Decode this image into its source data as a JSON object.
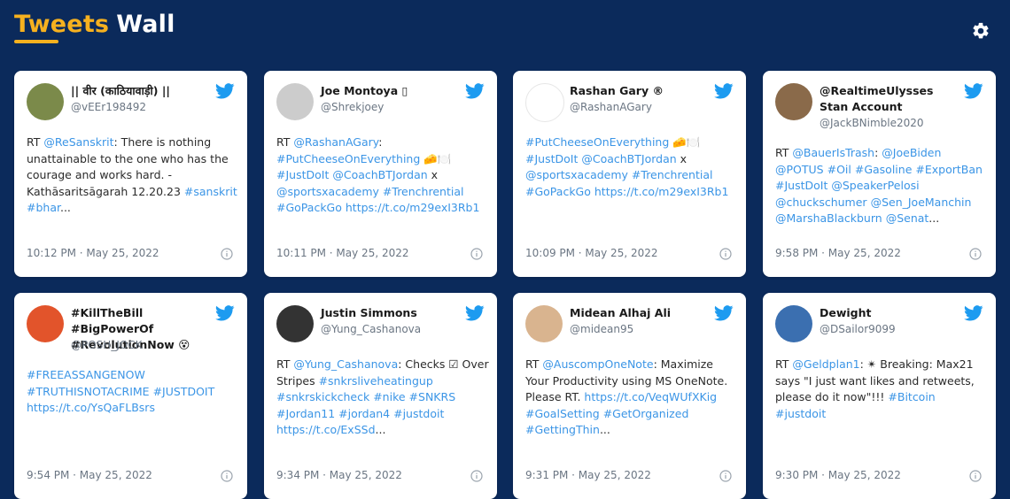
{
  "header": {
    "title_part1": "Tweets",
    "title_part2": "Wall"
  },
  "icons": {
    "settings": "gear-icon",
    "twitter": "twitter-bird-icon",
    "info": "info-circle-icon"
  },
  "colors": {
    "background": "#0b2a5b",
    "accent": "#f6b11f",
    "link": "#3b95e6",
    "twitter_blue": "#1d9bf0"
  },
  "tweets": [
    {
      "name": "|| वीर (काठियावाड़ी) ||",
      "handle": "@vEEr198492",
      "text_parts": [
        {
          "t": "RT ",
          "link": false
        },
        {
          "t": "@ReSanskrit",
          "link": true
        },
        {
          "t": ": There is nothing unattainable to the one who has the courage and works hard. - Kathāsaritsāgarah 12.20.23 ",
          "link": false
        },
        {
          "t": "#sanskrit",
          "link": true
        },
        {
          "t": " ",
          "link": false
        },
        {
          "t": "#bhar",
          "link": true
        },
        {
          "t": "...",
          "link": false
        }
      ],
      "time": "10:12 PM · May 25, 2022",
      "avatar_color": "#7b8a4a"
    },
    {
      "name": "Joe Montoya ▯",
      "handle": "@Shrekjoey",
      "text_parts": [
        {
          "t": "RT ",
          "link": false
        },
        {
          "t": "@RashanAGary",
          "link": true
        },
        {
          "t": ": ",
          "link": false
        },
        {
          "t": "#PutCheeseOnEverything",
          "link": true
        },
        {
          "t": " 🧀🍽️ ",
          "link": false
        },
        {
          "t": "#JustDoIt",
          "link": true
        },
        {
          "t": " ",
          "link": false
        },
        {
          "t": "@CoachBTJordan",
          "link": true
        },
        {
          "t": " x ",
          "link": false
        },
        {
          "t": "@sportsxacademy",
          "link": true
        },
        {
          "t": " ",
          "link": false
        },
        {
          "t": "#Trenchrential",
          "link": true
        },
        {
          "t": " ",
          "link": false
        },
        {
          "t": "#GoPackGo",
          "link": true
        },
        {
          "t": " ",
          "link": false
        },
        {
          "t": "https://t.co/m29exI3Rb1",
          "link": true
        }
      ],
      "time": "10:11 PM · May 25, 2022",
      "avatar_color": "#cccccc"
    },
    {
      "name": "Rashan Gary ®",
      "handle": "@RashanAGary",
      "text_parts": [
        {
          "t": "#PutCheeseOnEverything",
          "link": true
        },
        {
          "t": " 🧀🍽️ ",
          "link": false
        },
        {
          "t": "#JustDoIt",
          "link": true
        },
        {
          "t": " ",
          "link": false
        },
        {
          "t": "@CoachBTJordan",
          "link": true
        },
        {
          "t": " x ",
          "link": false
        },
        {
          "t": "@sportsxacademy",
          "link": true
        },
        {
          "t": " ",
          "link": false
        },
        {
          "t": "#Trenchrential",
          "link": true
        },
        {
          "t": " ",
          "link": false
        },
        {
          "t": "#GoPackGo",
          "link": true
        },
        {
          "t": " ",
          "link": false
        },
        {
          "t": "https://t.co/m29exI3Rb1",
          "link": true
        }
      ],
      "time": "10:09 PM · May 25, 2022",
      "avatar_color": "#ffffff"
    },
    {
      "name": "@RealtimeUlysses Stan Account",
      "handle": "@JackBNimble2020",
      "text_parts": [
        {
          "t": "RT ",
          "link": false
        },
        {
          "t": "@BauerIsTrash",
          "link": true
        },
        {
          "t": ": ",
          "link": false
        },
        {
          "t": "@JoeBiden",
          "link": true
        },
        {
          "t": " ",
          "link": false
        },
        {
          "t": "@POTUS",
          "link": true
        },
        {
          "t": " ",
          "link": false
        },
        {
          "t": "#Oil",
          "link": true
        },
        {
          "t": " ",
          "link": false
        },
        {
          "t": "#Gasoline",
          "link": true
        },
        {
          "t": " ",
          "link": false
        },
        {
          "t": "#ExportBan",
          "link": true
        },
        {
          "t": " ",
          "link": false
        },
        {
          "t": "#JustDoIt",
          "link": true
        },
        {
          "t": " ",
          "link": false
        },
        {
          "t": "@SpeakerPelosi",
          "link": true
        },
        {
          "t": " ",
          "link": false
        },
        {
          "t": "@chuckschumer",
          "link": true
        },
        {
          "t": " ",
          "link": false
        },
        {
          "t": "@Sen_JoeManchin",
          "link": true
        },
        {
          "t": " ",
          "link": false
        },
        {
          "t": "@MarshaBlackburn",
          "link": true
        },
        {
          "t": " ",
          "link": false
        },
        {
          "t": "@Senat",
          "link": true
        },
        {
          "t": "...",
          "link": false
        }
      ],
      "time": "9:58 PM · May 25, 2022",
      "avatar_color": "#8a6a4a"
    },
    {
      "name": "#KillTheBill #BigPowerOf #RevolutionNow 😵",
      "handle": "@POSH_JOCK",
      "text_parts": [
        {
          "t": "#FREEASSANGENOW",
          "link": true
        },
        {
          "t": " ",
          "link": false
        },
        {
          "t": "#TRUTHISNOTACRIME",
          "link": true
        },
        {
          "t": " ",
          "link": false
        },
        {
          "t": "#JUSTDOIT",
          "link": true
        },
        {
          "t": " ",
          "link": false
        },
        {
          "t": "https://t.co/YsQaFLBsrs",
          "link": true
        }
      ],
      "time": "9:54 PM · May 25, 2022",
      "avatar_color": "#e2542b"
    },
    {
      "name": "Justin Simmons",
      "handle": "@Yung_Cashanova",
      "text_parts": [
        {
          "t": "RT ",
          "link": false
        },
        {
          "t": "@Yung_Cashanova",
          "link": true
        },
        {
          "t": ": Checks ☑ Over Stripes ",
          "link": false
        },
        {
          "t": "#snkrsliveheatingup",
          "link": true
        },
        {
          "t": " ",
          "link": false
        },
        {
          "t": "#snkrskickcheck",
          "link": true
        },
        {
          "t": " ",
          "link": false
        },
        {
          "t": "#nike",
          "link": true
        },
        {
          "t": " ",
          "link": false
        },
        {
          "t": "#SNKRS",
          "link": true
        },
        {
          "t": " ",
          "link": false
        },
        {
          "t": "#Jordan11",
          "link": true
        },
        {
          "t": " ",
          "link": false
        },
        {
          "t": "#jordan4",
          "link": true
        },
        {
          "t": " ",
          "link": false
        },
        {
          "t": "#justdoit",
          "link": true
        },
        {
          "t": " ",
          "link": false
        },
        {
          "t": "https://t.co/ExSSd",
          "link": true
        },
        {
          "t": "...",
          "link": false
        }
      ],
      "time": "9:34 PM · May 25, 2022",
      "avatar_color": "#333333"
    },
    {
      "name": "Midean Alhaj Ali",
      "handle": "@midean95",
      "text_parts": [
        {
          "t": "RT ",
          "link": false
        },
        {
          "t": "@AuscompOneNote",
          "link": true
        },
        {
          "t": ": Maximize Your Productivity using MS OneNote. Please RT. ",
          "link": false
        },
        {
          "t": "https://t.co/VeqWUfXKig",
          "link": true
        },
        {
          "t": " ",
          "link": false
        },
        {
          "t": "#GoalSetting",
          "link": true
        },
        {
          "t": " ",
          "link": false
        },
        {
          "t": "#GetOrganized",
          "link": true
        },
        {
          "t": " ",
          "link": false
        },
        {
          "t": "#GettingThin",
          "link": true
        },
        {
          "t": "...",
          "link": false
        }
      ],
      "time": "9:31 PM · May 25, 2022",
      "avatar_color": "#d9b48f"
    },
    {
      "name": "Dewight",
      "handle": "@DSailor9099",
      "text_parts": [
        {
          "t": "RT ",
          "link": false
        },
        {
          "t": "@Geldplan1",
          "link": true
        },
        {
          "t": ": ✴ Breaking: Max21 says \"I just want likes and retweets, please do it now\"!!! ",
          "link": false
        },
        {
          "t": "#Bitcoin",
          "link": true
        },
        {
          "t": " ",
          "link": false
        },
        {
          "t": "#justdoit",
          "link": true
        }
      ],
      "time": "9:30 PM · May 25, 2022",
      "avatar_color": "#3b6fb0"
    }
  ]
}
